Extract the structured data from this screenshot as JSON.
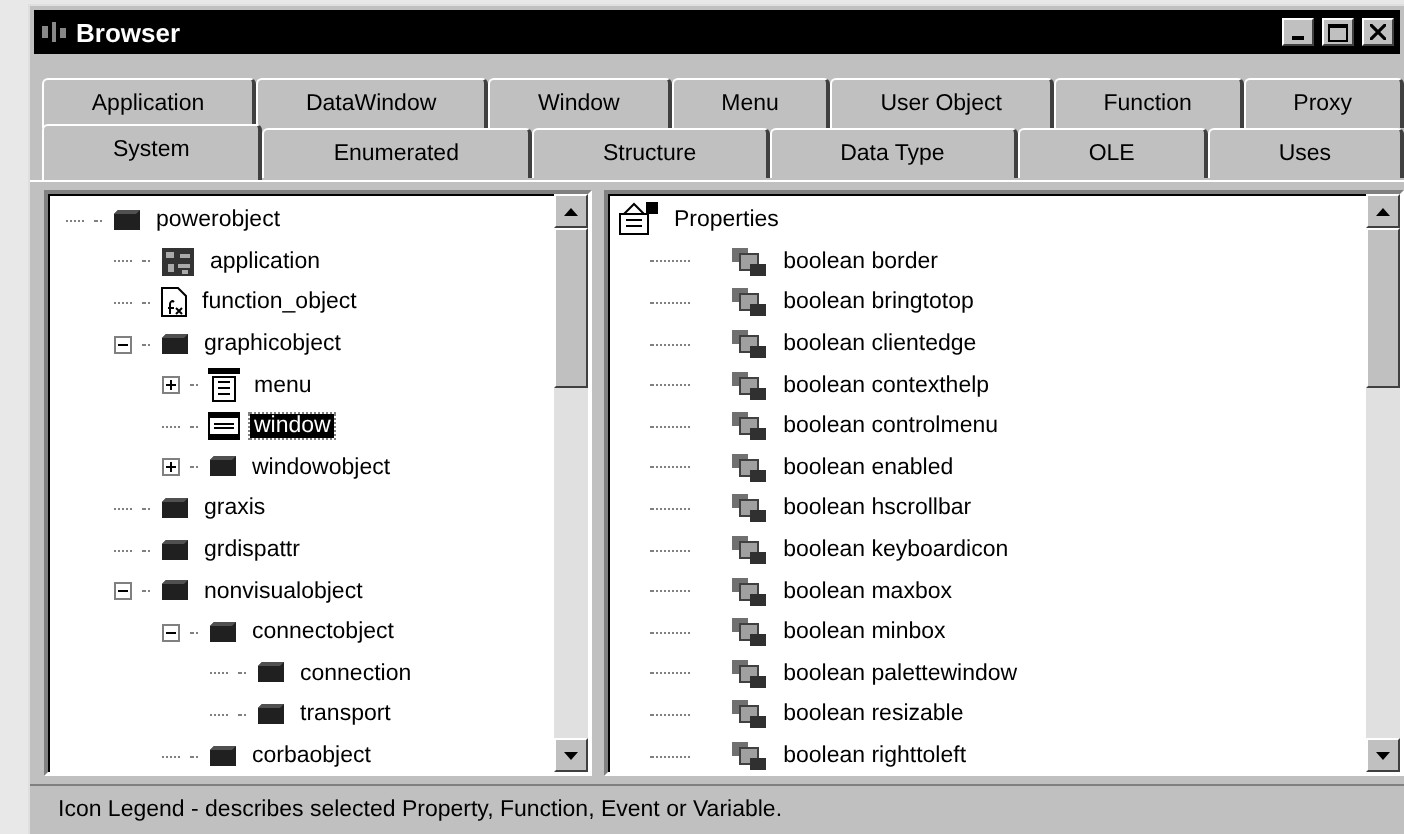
{
  "window": {
    "title": "Browser"
  },
  "tab_rows": [
    [
      {
        "label": "Application",
        "selected": false
      },
      {
        "label": "DataWindow",
        "selected": false
      },
      {
        "label": "Window",
        "selected": false
      },
      {
        "label": "Menu",
        "selected": false
      },
      {
        "label": "User Object",
        "selected": false
      },
      {
        "label": "Function",
        "selected": false
      },
      {
        "label": "Proxy",
        "selected": false
      }
    ],
    [
      {
        "label": "System",
        "selected": true
      },
      {
        "label": "Enumerated",
        "selected": false
      },
      {
        "label": "Structure",
        "selected": false
      },
      {
        "label": "Data Type",
        "selected": false
      },
      {
        "label": "OLE",
        "selected": false
      },
      {
        "label": "Uses",
        "selected": false
      }
    ]
  ],
  "tree": [
    {
      "label": "powerobject",
      "kind": "class",
      "selected": false,
      "children": [
        {
          "label": "application",
          "kind": "application",
          "selected": false
        },
        {
          "label": "function_object",
          "kind": "function",
          "selected": false
        },
        {
          "label": "graphicobject",
          "kind": "class",
          "selected": false,
          "expanded": true,
          "children": [
            {
              "label": "menu",
              "kind": "menu",
              "selected": false,
              "expanded": false
            },
            {
              "label": "window",
              "kind": "window",
              "selected": true
            },
            {
              "label": "windowobject",
              "kind": "class",
              "selected": false,
              "expanded": false
            }
          ]
        },
        {
          "label": "graxis",
          "kind": "class",
          "selected": false
        },
        {
          "label": "grdispattr",
          "kind": "class",
          "selected": false
        },
        {
          "label": "nonvisualobject",
          "kind": "class",
          "selected": false,
          "expanded": true,
          "children": [
            {
              "label": "connectobject",
              "kind": "class",
              "selected": false,
              "expanded": true,
              "children": [
                {
                  "label": "connection",
                  "kind": "class",
                  "selected": false
                },
                {
                  "label": "transport",
                  "kind": "class",
                  "selected": false
                }
              ]
            },
            {
              "label": "corbaobject",
              "kind": "class",
              "selected": false
            }
          ]
        }
      ]
    }
  ],
  "details": {
    "heading": "Properties",
    "items": [
      {
        "label": "boolean border"
      },
      {
        "label": "boolean bringtotop"
      },
      {
        "label": "boolean clientedge"
      },
      {
        "label": "boolean contexthelp"
      },
      {
        "label": "boolean controlmenu"
      },
      {
        "label": "boolean enabled"
      },
      {
        "label": "boolean hscrollbar"
      },
      {
        "label": "boolean keyboardicon"
      },
      {
        "label": "boolean maxbox"
      },
      {
        "label": "boolean minbox"
      },
      {
        "label": "boolean palettewindow"
      },
      {
        "label": "boolean resizable"
      },
      {
        "label": "boolean righttoleft"
      }
    ]
  },
  "status_bar": "Icon Legend - describes selected Property, Function, Event or Variable."
}
